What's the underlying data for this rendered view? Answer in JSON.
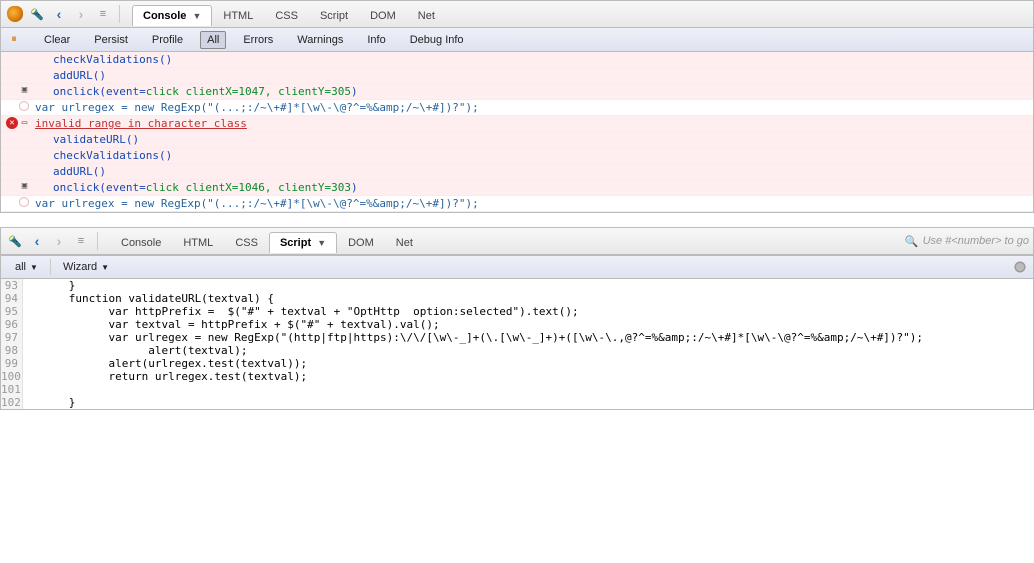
{
  "top": {
    "tabs": {
      "console": "Console",
      "html": "HTML",
      "css": "CSS",
      "script": "Script",
      "dom": "DOM",
      "net": "Net"
    },
    "subbar": {
      "clear": "Clear",
      "persist": "Persist",
      "profile": "Profile",
      "all": "All",
      "errors": "Errors",
      "warnings": "Warnings",
      "info": "Info",
      "debug": "Debug Info"
    }
  },
  "console_lines": {
    "l1": "checkValidations()",
    "l2": "addURL()",
    "l3a": "onclick(event=",
    "l3b": "click clientX=1047, clientY=305",
    "l3c": ")",
    "l4": "var urlregex = new RegExp(\"(...;:/~\\+#]*[\\w\\-\\@?^=%&amp;/~\\+#])?\");",
    "l5": "invalid range in character class",
    "l6": "validateURL()",
    "l7": "checkValidations()",
    "l8": "addURL()",
    "l9a": "onclick(event=",
    "l9b": "click clientX=1046, clientY=303",
    "l9c": ")",
    "l10": "var urlregex = new RegExp(\"(...;:/~\\+#]*[\\w\\-\\@?^=%&amp;/~\\+#])?\");"
  },
  "bottom": {
    "tabs": {
      "console": "Console",
      "html": "HTML",
      "css": "CSS",
      "script": "Script",
      "dom": "DOM",
      "net": "Net"
    },
    "subbar": {
      "all": "all",
      "wizard": "Wizard"
    },
    "search_placeholder": "Use #<number> to go",
    "code": [
      {
        "n": "93",
        "t": "      }"
      },
      {
        "n": "94",
        "t": "      function validateURL(textval) {"
      },
      {
        "n": "95",
        "t": "            var httpPrefix =  $(\"#\" + textval + \"OptHttp  option:selected\").text();"
      },
      {
        "n": "96",
        "t": "            var textval = httpPrefix + $(\"#\" + textval).val();"
      },
      {
        "n": "97",
        "t": "            var urlregex = new RegExp(\"(http|ftp|https):\\/\\/[\\w\\-_]+(\\.[\\w\\-_]+)+([\\w\\-\\.,@?^=%&amp;:/~\\+#]*[\\w\\-\\@?^=%&amp;/~\\+#])?\");"
      },
      {
        "n": "98",
        "t": "                  alert(textval);"
      },
      {
        "n": "99",
        "t": "            alert(urlregex.test(textval));"
      },
      {
        "n": "100",
        "t": "            return urlregex.test(textval);"
      },
      {
        "n": "101",
        "t": ""
      },
      {
        "n": "102",
        "t": "      }"
      }
    ]
  }
}
